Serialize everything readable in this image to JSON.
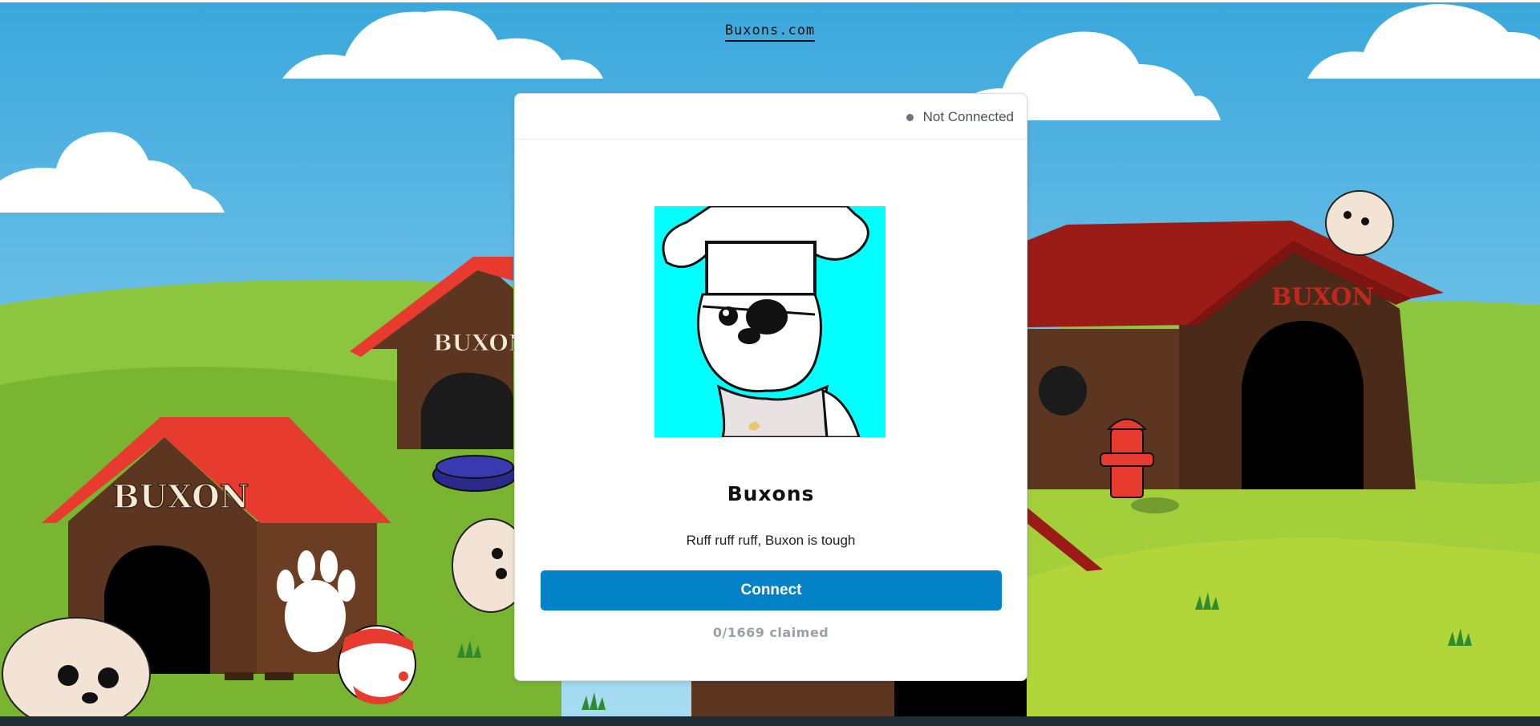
{
  "site": {
    "link_text": "Buxons.com"
  },
  "card": {
    "status_text": "Not Connected",
    "collection_name": "Buxons",
    "description": "Ruff ruff ruff, Buxon is tough",
    "connect_label": "Connect",
    "claimed_text": "0/1669 claimed"
  },
  "scene": {
    "doghouse_sign": "BUXON",
    "colors": {
      "sky_top": "#3aa7dc",
      "grass": "#8cc63f",
      "roof_red": "#e63b2e",
      "roof_dark_red": "#9b1c17",
      "house_brown": "#5c3620",
      "nft_background": "#00ffff",
      "button_blue": "#0482c8"
    }
  }
}
